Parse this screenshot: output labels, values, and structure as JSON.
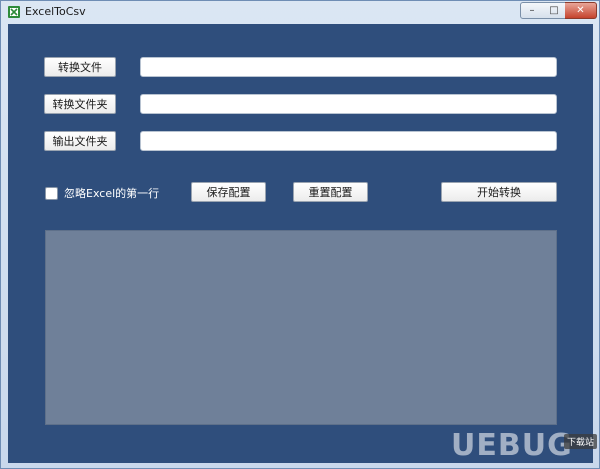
{
  "window": {
    "title": "ExcelToCsv",
    "controls": {
      "minimize": "–",
      "maximize": "□",
      "close": "✕"
    }
  },
  "form": {
    "convert_file_button": "转换文件",
    "convert_file_value": "",
    "convert_folder_button": "转换文件夹",
    "convert_folder_value": "",
    "output_folder_button": "输出文件夹",
    "output_folder_value": ""
  },
  "options": {
    "ignore_first_row_label": "忽略Excel的第一行",
    "ignore_first_row_checked": false
  },
  "actions": {
    "save_config": "保存配置",
    "reset_config": "重置配置",
    "start_convert": "开始转换"
  },
  "log": {
    "content": ""
  },
  "watermark": {
    "text": "UEBUG",
    "badge": "下载站"
  },
  "colors": {
    "client_bg": "#2f4e7c",
    "log_bg": "#6f8099",
    "titlebar": "#c9d8ec"
  }
}
